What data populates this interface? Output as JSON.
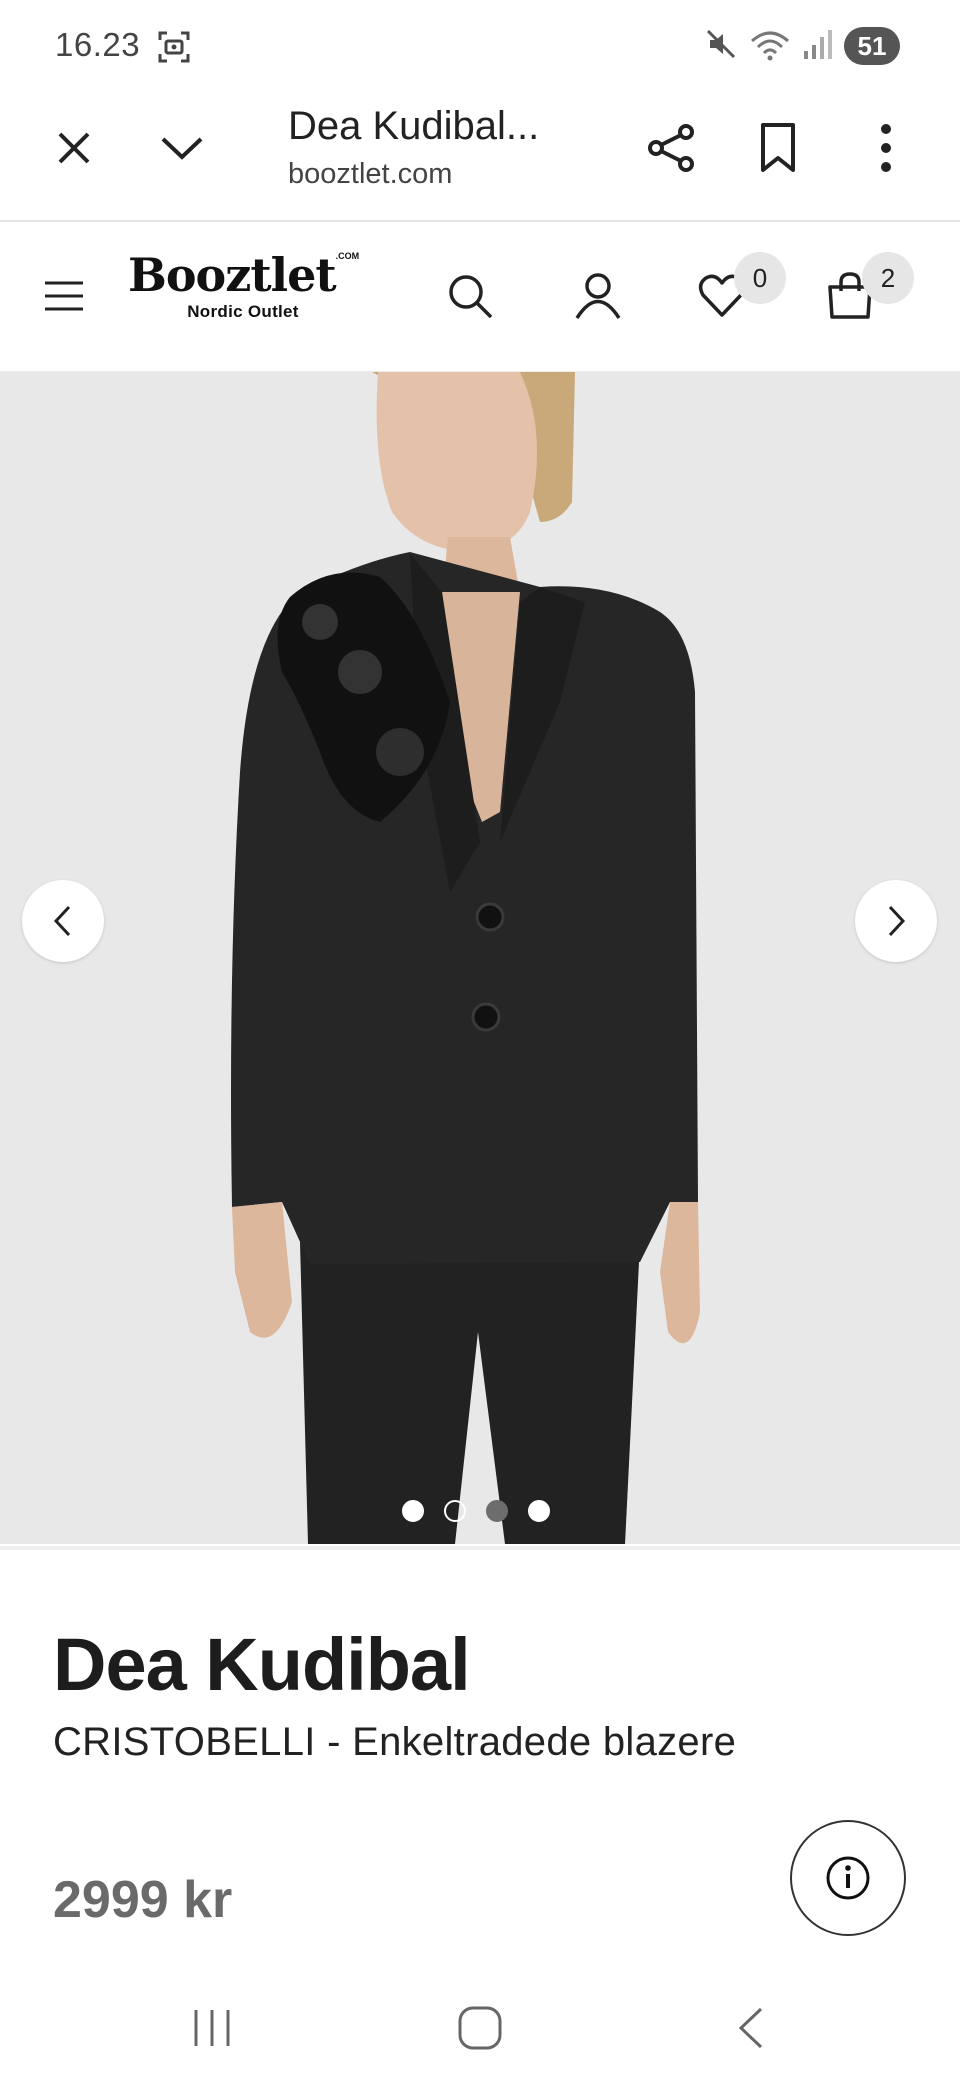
{
  "status_bar": {
    "time": "16.23",
    "battery": "51",
    "icons": [
      "screenshot-icon",
      "mute-icon",
      "wifi-icon",
      "signal-icon"
    ]
  },
  "browser": {
    "title": "Dea Kudibal...",
    "url": "booztlet.com",
    "icons": [
      "close-icon",
      "chevron-down-icon",
      "share-icon",
      "bookmark-icon",
      "more-vert-icon"
    ]
  },
  "site_header": {
    "logo_main": "Booztlet",
    "logo_com": ".COM",
    "logo_sub": "Nordic Outlet",
    "wishlist_count": "0",
    "cart_count": "2",
    "icons": [
      "menu-icon",
      "search-icon",
      "account-icon",
      "heart-icon",
      "bag-icon"
    ]
  },
  "gallery": {
    "image_count": 4,
    "active_index": 2,
    "icons": [
      "chevron-left-icon",
      "chevron-right-icon"
    ]
  },
  "product": {
    "brand": "Dea Kudibal",
    "name": "CRISTOBELLI - Enkeltradede blazere",
    "price": "2999 kr",
    "icons": [
      "info-icon"
    ]
  },
  "nav_bar": {
    "icons": [
      "recents-icon",
      "home-icon",
      "back-icon"
    ]
  },
  "colors": {
    "accent": "#222222",
    "price": "#6a6a6a",
    "gallery_bg": "#e9e9e9",
    "badge_bg": "#e6e6e6"
  }
}
